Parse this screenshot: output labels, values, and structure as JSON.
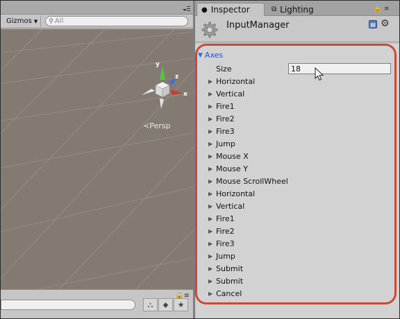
{
  "scene": {
    "gizmos_label": "Gizmos",
    "search_placeholder": "All",
    "persp_label": "Persp",
    "gizmo_axes": {
      "y": "y",
      "x": "x",
      "z": "z"
    }
  },
  "inspector": {
    "tabs": [
      {
        "label": "Inspector",
        "icon": "info-icon"
      },
      {
        "label": "Lighting",
        "icon": "lighting-icon"
      }
    ],
    "asset_name": "InputManager",
    "axes_label": "Axes",
    "size_label": "Size",
    "size_value": "18",
    "axes": [
      "Horizontal",
      "Vertical",
      "Fire1",
      "Fire2",
      "Fire3",
      "Jump",
      "Mouse X",
      "Mouse Y",
      "Mouse ScrollWheel",
      "Horizontal",
      "Vertical",
      "Fire1",
      "Fire2",
      "Fire3",
      "Jump",
      "Submit",
      "Submit",
      "Cancel"
    ]
  },
  "colors": {
    "highlight_outline": "#c94a3a",
    "foldout_blue": "#1f4fcf",
    "viewport_bg": "#837a72"
  }
}
